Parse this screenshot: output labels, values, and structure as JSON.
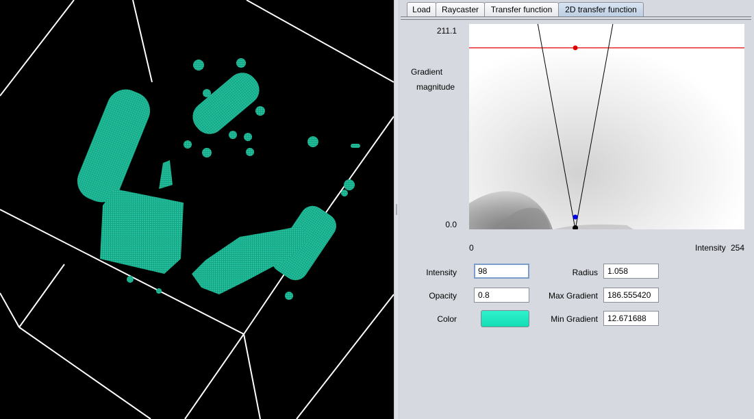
{
  "tabs": [
    {
      "label": "Load"
    },
    {
      "label": "Raycaster"
    },
    {
      "label": "Transfer function"
    },
    {
      "label": "2D transfer function",
      "active": true
    }
  ],
  "plot": {
    "y_max_label": "211.1",
    "y_min_label": "0.0",
    "y_axis_label_line1": "Gradient",
    "y_axis_label_line2": "magnitude",
    "x_min_label": "0",
    "x_axis_label": "Intensity",
    "x_max_label": "254",
    "colors": {
      "max_gradient_line": "#e00000",
      "triangle_lines": "#000000",
      "radius_marker": "#0000ee",
      "apex_marker": "#000000"
    }
  },
  "controls": {
    "intensity_label": "Intensity",
    "intensity_value": "98",
    "opacity_label": "Opacity",
    "opacity_value": "0.8",
    "color_label": "Color",
    "color_value": "#1fe8c0",
    "radius_label": "Radius",
    "radius_value": "1.058",
    "max_gradient_label": "Max Gradient",
    "max_gradient_value": "186.555420",
    "min_gradient_label": "Min Gradient",
    "min_gradient_value": "12.671688"
  },
  "render": {
    "volume_color": "#14a88a",
    "bbox_color": "#ffffff",
    "background": "#000000"
  }
}
